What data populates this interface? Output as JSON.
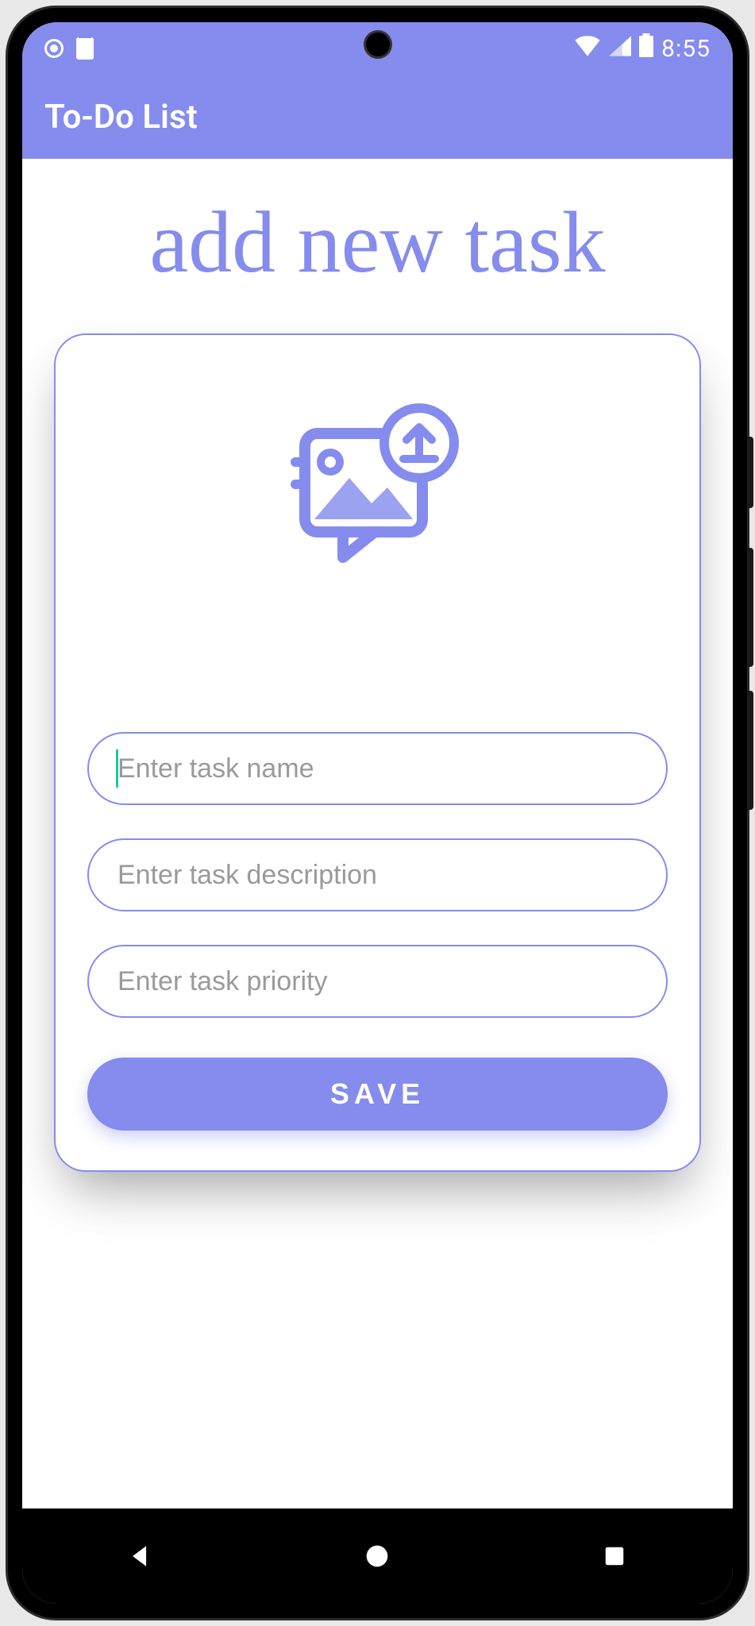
{
  "status_bar": {
    "time": "8:55"
  },
  "app_bar": {
    "title": "To-Do List"
  },
  "page": {
    "heading": "add new task"
  },
  "form": {
    "task_name": {
      "value": "",
      "placeholder": "Enter task name"
    },
    "task_description": {
      "value": "",
      "placeholder": "Enter task description"
    },
    "task_priority": {
      "value": "",
      "placeholder": "Enter task priority"
    },
    "save_label": "SAVE"
  }
}
